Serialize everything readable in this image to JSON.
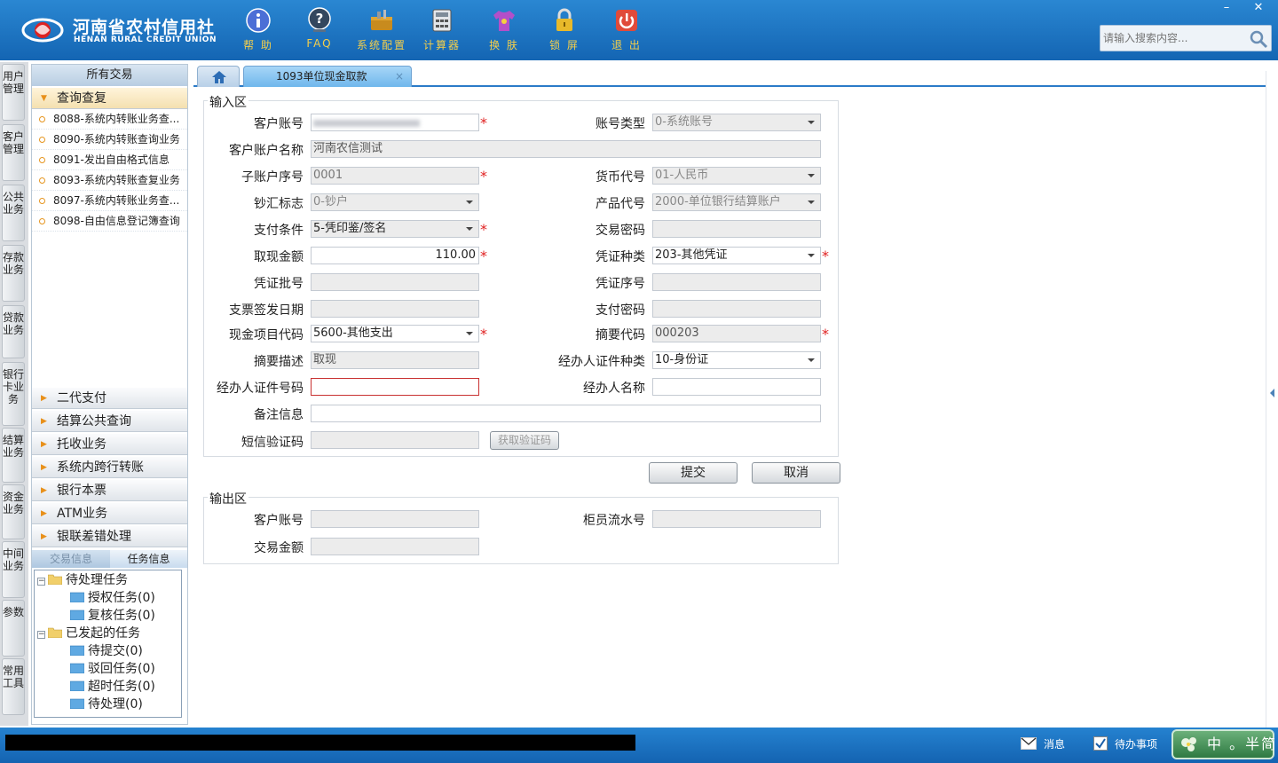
{
  "app": {
    "logo_cn": "河南省农村信用社",
    "logo_en": "HENAN RURAL CREDIT UNION",
    "toolbar": [
      {
        "label": "帮 助",
        "icon": "info-icon"
      },
      {
        "label": "FAQ",
        "icon": "faq-icon"
      },
      {
        "label": "系统配置",
        "icon": "toolbox-icon"
      },
      {
        "label": "计算器",
        "icon": "calculator-icon"
      },
      {
        "label": "换 肤",
        "icon": "tshirt-icon"
      },
      {
        "label": "锁 屏",
        "icon": "lock-icon"
      },
      {
        "label": "退 出",
        "icon": "power-icon"
      }
    ],
    "window": {
      "minimize": "–",
      "close": "✕"
    },
    "search": {
      "placeholder": "请输入搜索内容..."
    }
  },
  "vnav": [
    "用户管理",
    "客户管理",
    "公共业务",
    "存款业务",
    "贷款业务",
    "银行卡业务",
    "结算业务",
    "资金业务",
    "中间业务",
    "参数",
    "常用工具"
  ],
  "sidebar": {
    "all_tx": "所有交易",
    "query_group": "查询查复",
    "query_items": [
      "8088-系统内转账业务查...",
      "8090-系统内转账查询业务",
      "8091-发出自由格式信息",
      "8093-系统内转账查复业务",
      "8097-系统内转账业务查...",
      "8098-自由信息登记簿查询"
    ],
    "groups": [
      "二代支付",
      "结算公共查询",
      "托收业务",
      "系统内跨行转账",
      "银行本票",
      "ATM业务",
      "银联差错处理"
    ],
    "task_tabs": {
      "tx_info": "交易信息",
      "task_info": "任务信息"
    },
    "tree": {
      "pending": "待处理任务",
      "pending_children": [
        "授权任务(0)",
        "复核任务(0)"
      ],
      "started": "已发起的任务",
      "started_children": [
        "待提交(0)",
        "驳回任务(0)",
        "超时任务(0)",
        "待处理(0)"
      ]
    }
  },
  "tabs": {
    "main": "1093单位现金取款",
    "close": "×"
  },
  "input_area": {
    "title": "输入区",
    "labels": {
      "cust_acct": "客户账号",
      "acct_type": "账号类型",
      "acct_name": "客户账户名称",
      "sub_seq": "子账户序号",
      "currency": "货币代号",
      "cash_flag": "钞汇标志",
      "product": "产品代号",
      "pay_cond": "支付条件",
      "tx_pwd": "交易密码",
      "amount": "取现金额",
      "voucher_type": "凭证种类",
      "voucher_batch": "凭证批号",
      "voucher_seq": "凭证序号",
      "check_date": "支票签发日期",
      "pay_pwd": "支付密码",
      "cash_item": "现金项目代码",
      "summary_code": "摘要代码",
      "summary_desc": "摘要描述",
      "agent_id_type": "经办人证件种类",
      "agent_id_no": "经办人证件号码",
      "agent_name": "经办人名称",
      "remark": "备注信息",
      "sms_code": "短信验证码"
    },
    "values": {
      "acct_type": "0-系统账号",
      "acct_name": "河南农信测试",
      "sub_seq": "0001",
      "currency": "01-人民币",
      "cash_flag": "0-钞户",
      "product": "2000-单位银行结算账户",
      "pay_cond": "5-凭印鉴/签名",
      "amount": "110.00",
      "voucher_type": "203-其他凭证",
      "cash_item": "5600-其他支出",
      "summary_code": "000203",
      "summary_desc": "取现",
      "agent_id_type": "10-身份证"
    },
    "get_code_button": "获取验证码"
  },
  "actions": {
    "submit": "提交",
    "cancel": "取消"
  },
  "output_area": {
    "title": "输出区",
    "labels": {
      "cust_acct": "客户账号",
      "teller_seq": "柜员流水号",
      "tx_amount": "交易金额"
    }
  },
  "statusbar": {
    "message": "消息",
    "todo": "待办事项",
    "ime": "中 。半简"
  },
  "colors": {
    "topbar": "#1f78c8",
    "required": "#e02020",
    "accent_orange": "#e8901a"
  }
}
